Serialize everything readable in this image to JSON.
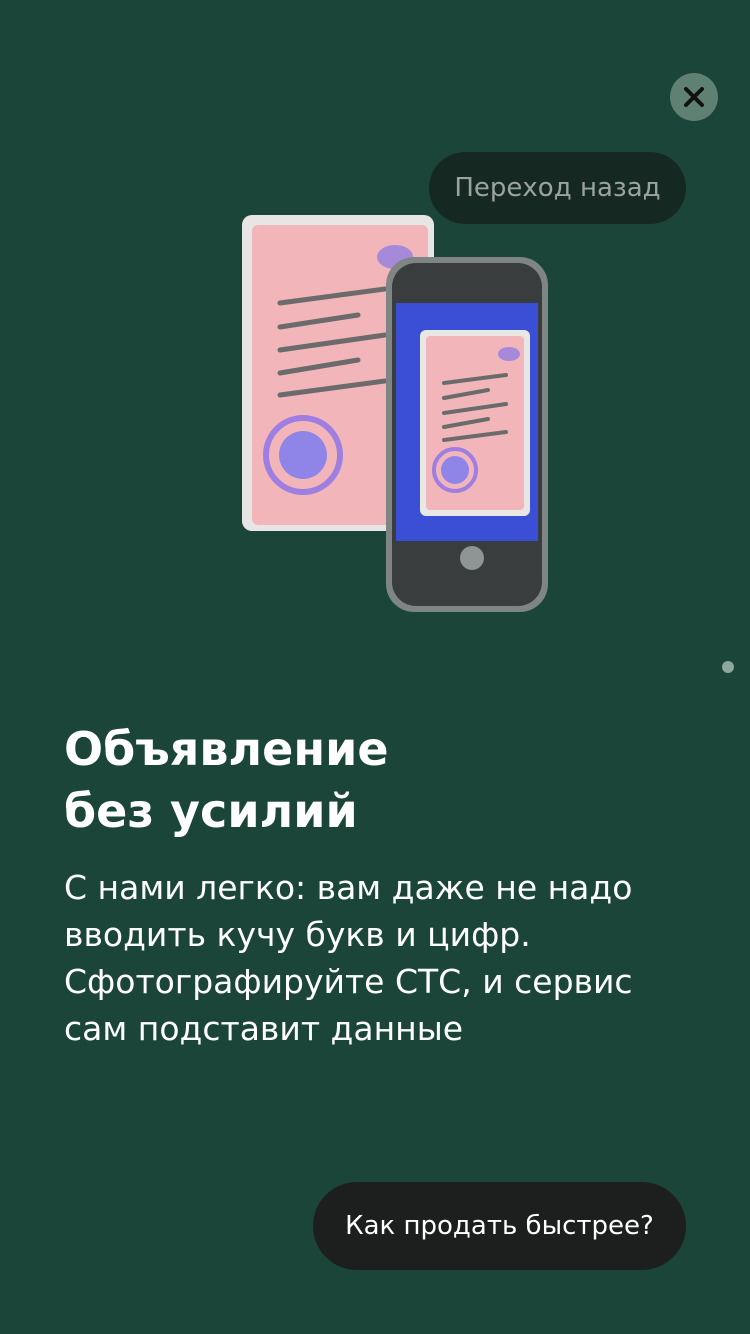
{
  "header": {
    "close_icon": "close-icon",
    "back_label": "Переход назад"
  },
  "illustration": {
    "icon": "document-phone-scan-illustration"
  },
  "pager": {
    "total": 1,
    "active": 1
  },
  "content": {
    "title_line1": "Объявление",
    "title_line2": "без усилий",
    "description_line1": "С нами легко: вам даже не надо",
    "description_line2": "вводить кучу букв и цифр.",
    "description_line3": "Сфотографируйте СТС, и сервис",
    "description_line4": "сам подставит данные"
  },
  "footer": {
    "cta_label": "Как продать быстрее?"
  },
  "colors": {
    "background": "#1a4538",
    "button_dark": "#1d1f1e",
    "close_bg": "#5f8173",
    "document_pink": "#f2b6ba",
    "accent_purple": "#8f85e8",
    "phone_screen": "#3b4fd6"
  }
}
